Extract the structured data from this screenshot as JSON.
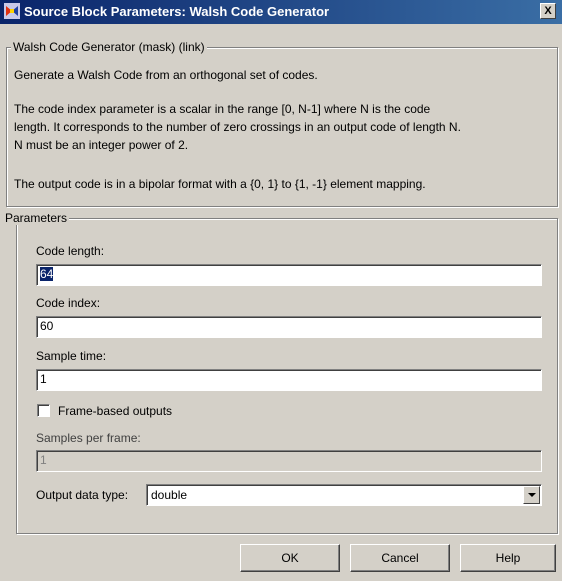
{
  "window": {
    "title": "Source Block Parameters: Walsh Code Generator",
    "close_label": "X"
  },
  "description": {
    "group_label": "Walsh Code Generator (mask) (link)",
    "lines": [
      "Generate a Walsh Code from an orthogonal set of codes.",
      "The code index parameter is a scalar in the range [0, N-1] where N is the code",
      "length.  It corresponds to the number of zero crossings in an output code of length N.",
      "N must be an integer power of 2.",
      "The output code is in a bipolar format with a {0, 1} to {1, -1} element mapping."
    ]
  },
  "parameters": {
    "group_label": "Parameters",
    "code_length": {
      "label": "Code length:",
      "value": "64"
    },
    "code_index": {
      "label": "Code index:",
      "value": "60"
    },
    "sample_time": {
      "label": "Sample time:",
      "value": "1"
    },
    "frame_based": {
      "label": "Frame-based outputs",
      "checked": false
    },
    "samples_per_frame": {
      "label": "Samples per frame:",
      "value": "1",
      "disabled": true
    },
    "output_data_type": {
      "label": "Output data type:",
      "value": "double"
    }
  },
  "buttons": {
    "ok": "OK",
    "cancel": "Cancel",
    "help": "Help"
  }
}
